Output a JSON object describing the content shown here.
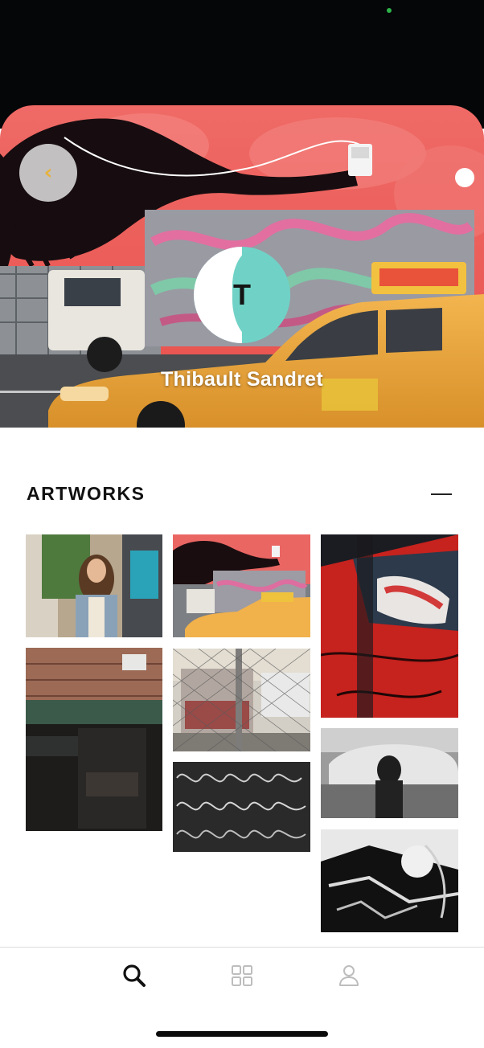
{
  "status": {
    "camera_indicator_color": "#2fb34a"
  },
  "header": {
    "back_icon": "chevron-left-icon",
    "avatar_initial": "T",
    "profile_name": "Thibault Sandret",
    "accent_color": "#70d2c6"
  },
  "artworks": {
    "title": "ARTWORKS",
    "collapse_icon": "minus-icon",
    "items": [
      {
        "subject": "woman-sunglasses-street"
      },
      {
        "subject": "yellow-taxi-mural"
      },
      {
        "subject": "red-car-graffiti"
      },
      {
        "subject": "brick-building-storefront"
      },
      {
        "subject": "truck-behind-fence"
      },
      {
        "subject": "graffiti-wall-bw"
      },
      {
        "subject": "woman-by-car-bw"
      },
      {
        "subject": "graffiti-under-bridge-bw"
      }
    ]
  },
  "nav": {
    "items": [
      {
        "icon": "search-icon",
        "active": true
      },
      {
        "icon": "grid-icon",
        "active": false
      },
      {
        "icon": "user-icon",
        "active": false
      }
    ]
  }
}
